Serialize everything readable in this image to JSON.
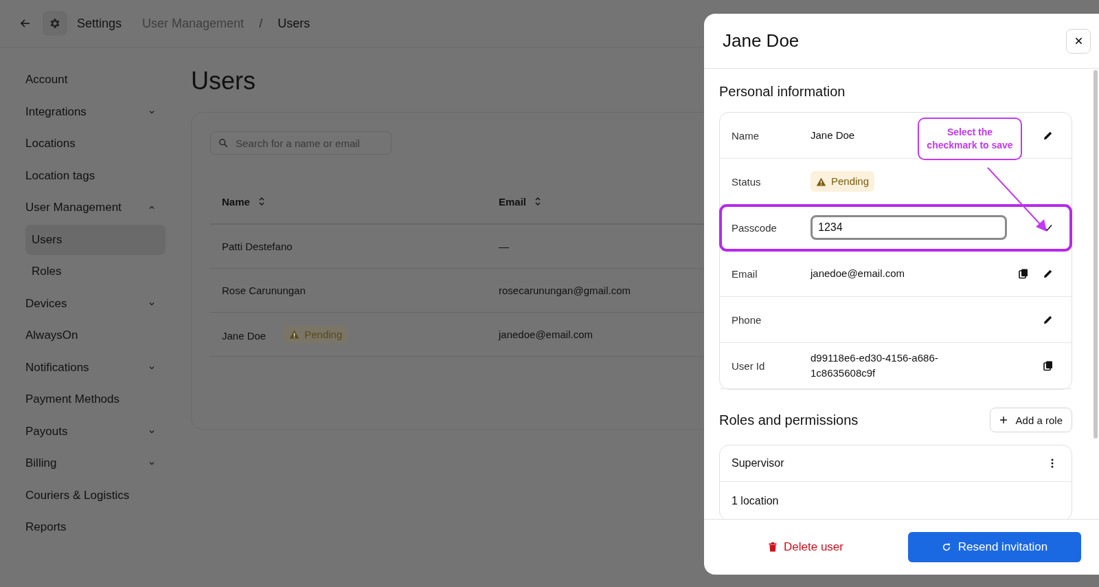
{
  "topbar": {
    "app": "Settings",
    "breadcrumb": [
      "User Management",
      "Users"
    ],
    "separator": "/"
  },
  "sidebar": {
    "items": [
      {
        "label": "Account"
      },
      {
        "label": "Integrations",
        "expanded": false
      },
      {
        "label": "Locations"
      },
      {
        "label": "Location tags"
      },
      {
        "label": "User Management",
        "expanded": true,
        "children": [
          {
            "label": "Users",
            "selected": true
          },
          {
            "label": "Roles",
            "selected": false
          }
        ]
      },
      {
        "label": "Devices",
        "expanded": false
      },
      {
        "label": "AlwaysOn"
      },
      {
        "label": "Notifications",
        "expanded": false
      },
      {
        "label": "Payment Methods"
      },
      {
        "label": "Payouts",
        "expanded": false
      },
      {
        "label": "Billing",
        "expanded": false
      },
      {
        "label": "Couriers & Logistics"
      },
      {
        "label": "Reports"
      }
    ]
  },
  "page": {
    "title": "Users",
    "search": {
      "placeholder": "Search for a name or email"
    },
    "table": {
      "columns": [
        "Name",
        "Email"
      ],
      "rows": [
        {
          "name": "Patti Destefano",
          "email": "—"
        },
        {
          "name": "Rose Carunungan",
          "email": "rosecarunungan@gmail.com"
        },
        {
          "name": "Jane Doe",
          "status": "Pending",
          "email": "janedoe@email.com"
        }
      ]
    }
  },
  "drawer": {
    "title": "Jane Doe",
    "personal": {
      "heading": "Personal information",
      "rows": [
        {
          "label": "Name",
          "kind": "text",
          "value": "Jane Doe",
          "copyable": false,
          "editable": true,
          "highlighted": false
        },
        {
          "label": "Status",
          "kind": "badge",
          "value": "Pending",
          "copyable": false,
          "editable": false,
          "highlighted": false
        },
        {
          "label": "Passcode",
          "kind": "input",
          "value": "1234",
          "copyable": false,
          "editable": false,
          "highlighted": true
        },
        {
          "label": "Email",
          "kind": "text",
          "value": "janedoe@email.com",
          "copyable": true,
          "editable": true,
          "highlighted": false
        },
        {
          "label": "Phone",
          "kind": "text",
          "copyable": false,
          "editable": true,
          "highlighted": false
        },
        {
          "label": "User Id",
          "kind": "text",
          "value": "d99118e6-ed30-4156-a686-1c8635608c9f",
          "copyable": true,
          "editable": false,
          "highlighted": false
        }
      ],
      "callout": "Select the checkmark to save"
    },
    "roles": {
      "heading": "Roles and permissions",
      "add_button": "Add a role",
      "cards": [
        {
          "title": "Supervisor",
          "detail": "1 location"
        }
      ]
    },
    "footer": {
      "delete": "Delete user",
      "resend": "Resend invitation"
    }
  }
}
